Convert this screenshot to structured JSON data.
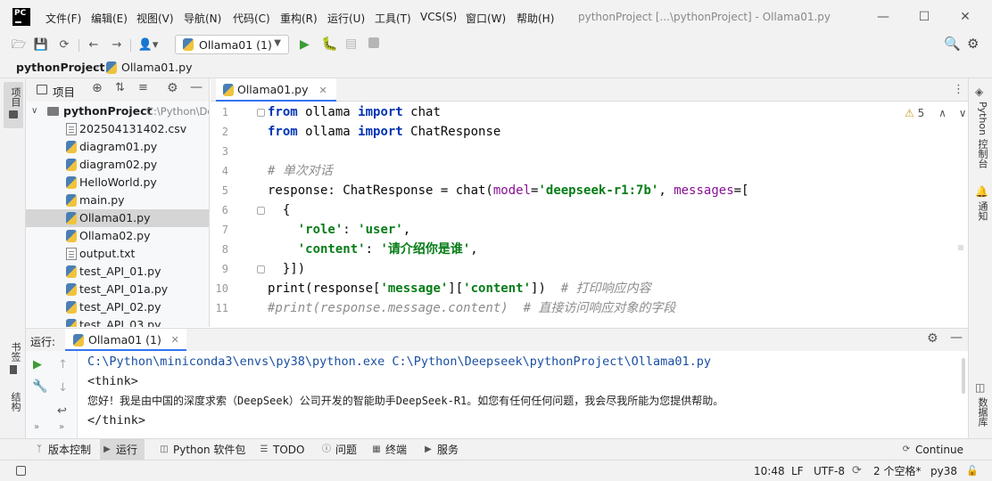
{
  "app": {
    "logo_text": "PC",
    "window_title": "pythonProject [...\\pythonProject] - Ollama01.py"
  },
  "menu": [
    "文件(F)",
    "编辑(E)",
    "视图(V)",
    "导航(N)",
    "代码(C)",
    "重构(R)",
    "运行(U)",
    "工具(T)",
    "VCS(S)",
    "窗口(W)",
    "帮助(H)"
  ],
  "toolbar": {
    "run_config": "Ollama01 (1)",
    "accent_run": "#3d9b35",
    "accent_debug": "#3d9b35"
  },
  "breadcrumb": {
    "project": "pythonProject",
    "file": "Ollama01.py"
  },
  "left_strip": {
    "project_label": "项目",
    "bookmarks_label": "书签",
    "structure_label": "结构"
  },
  "right_strip": {
    "python_console_label": "Python 控制台",
    "notifications_label": "通知",
    "database_label": "数据库"
  },
  "project_panel": {
    "title": "项目",
    "root_name": "pythonProject",
    "root_path": "C:\\Python\\Deepseek\\pythonProject",
    "files": [
      {
        "name": "202504131402.csv",
        "type": "csv"
      },
      {
        "name": "diagram01.py",
        "type": "py"
      },
      {
        "name": "diagram02.py",
        "type": "py"
      },
      {
        "name": "HelloWorld.py",
        "type": "py"
      },
      {
        "name": "main.py",
        "type": "py"
      },
      {
        "name": "Ollama01.py",
        "type": "py",
        "selected": true
      },
      {
        "name": "Ollama02.py",
        "type": "py"
      },
      {
        "name": "output.txt",
        "type": "txt"
      },
      {
        "name": "test_API_01.py",
        "type": "py"
      },
      {
        "name": "test_API_01a.py",
        "type": "py"
      },
      {
        "name": "test_API_02.py",
        "type": "py"
      },
      {
        "name": "test_API_03.py",
        "type": "py"
      }
    ]
  },
  "editor": {
    "tab_label": "Ollama01.py",
    "warning_count": "5",
    "lines": [
      {
        "n": "1"
      },
      {
        "n": "2"
      },
      {
        "n": "3"
      },
      {
        "n": "4"
      },
      {
        "n": "5"
      },
      {
        "n": "6"
      },
      {
        "n": "7"
      },
      {
        "n": "8"
      },
      {
        "n": "9"
      },
      {
        "n": "10"
      },
      {
        "n": "11"
      }
    ],
    "code": {
      "l1_kw1": "from",
      "l1_mod": " ollama ",
      "l1_kw2": "import",
      "l1_name": " chat",
      "l2_kw1": "from",
      "l2_mod": " ollama ",
      "l2_kw2": "import",
      "l2_name": " ChatResponse",
      "l4_comment": "# 单次对话",
      "l5_a": "response: ChatResponse = chat(",
      "l5_p1": "model",
      "l5_eq1": "=",
      "l5_s1": "'deepseek-r1:7b'",
      "l5_comma": ", ",
      "l5_p2": "messages",
      "l5_eq2": "=[",
      "l6": "  {",
      "l7_indent": "    ",
      "l7_key": "'role'",
      "l7_colon": ": ",
      "l7_val": "'user'",
      "l7_end": ",",
      "l8_indent": "    ",
      "l8_key": "'content'",
      "l8_colon": ": ",
      "l8_val": "'请介绍你是谁'",
      "l8_end": ",",
      "l9": "  }])",
      "l10_a": "print(response[",
      "l10_s1": "'message'",
      "l10_b": "][",
      "l10_s2": "'content'",
      "l10_c": "])  ",
      "l10_comment": "# 打印响应内容",
      "l11_comment": "#print(response.message.content)  # 直接访问响应对象的字段"
    }
  },
  "run_panel": {
    "label": "运行:",
    "tab": "Ollama01 (1)",
    "output": [
      {
        "text": "C:\\Python\\miniconda3\\envs\\py38\\python.exe C:\\Python\\Deepseek\\pythonProject\\Ollama01.py",
        "color": "#1a4fa3"
      },
      {
        "text": "<think>",
        "color": "#1f1f1f"
      },
      {
        "text": "您好！我是由中国的深度求索（DeepSeek）公司开发的智能助手DeepSeek-R1。如您有任何任何问题，我会尽我所能为您提供帮助。",
        "color": "#1f1f1f"
      },
      {
        "text": "</think>",
        "color": "#1f1f1f"
      }
    ]
  },
  "bottom_tabs": {
    "vcs": "版本控制",
    "run": "运行",
    "packages": "Python 软件包",
    "todo": "TODO",
    "problems": "问题",
    "terminal": "终端",
    "services": "服务",
    "continue": "Continue"
  },
  "status": {
    "position": "10:48",
    "line_sep": "LF",
    "encoding": "UTF-8",
    "indent": "2 个空格*",
    "interpreter": "py38"
  }
}
